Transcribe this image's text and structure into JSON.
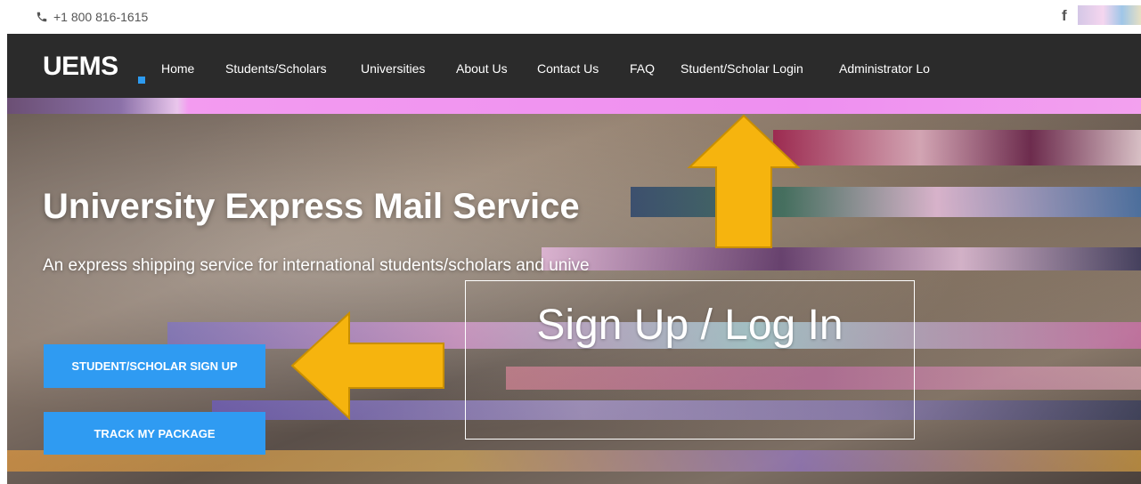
{
  "topbar": {
    "phone": "+1 800 816-1615",
    "facebook_glyph": "f",
    "icons": [
      "phone-icon",
      "facebook-icon"
    ]
  },
  "brand": {
    "logo": "UEMS",
    "accent_color": "#2d9bf0"
  },
  "nav": {
    "items": [
      "Home",
      "Students/Scholars",
      "Universities",
      "About Us",
      "Contact Us",
      "FAQ",
      "Student/Scholar Login",
      "Administrator Lo"
    ]
  },
  "hero": {
    "title": "University Express Mail Service",
    "subtitle": "An express shipping service for international students/scholars and unive",
    "signup_button": "STUDENT/SCHOLAR SIGN UP",
    "track_button": "TRACK MY PACKAGE",
    "button_color": "#2f9bf2"
  },
  "annotation": {
    "label": "Sign Up / Log In",
    "arrow_color": "#f6b40e",
    "icons": [
      "arrow-up-icon",
      "arrow-left-icon"
    ]
  }
}
